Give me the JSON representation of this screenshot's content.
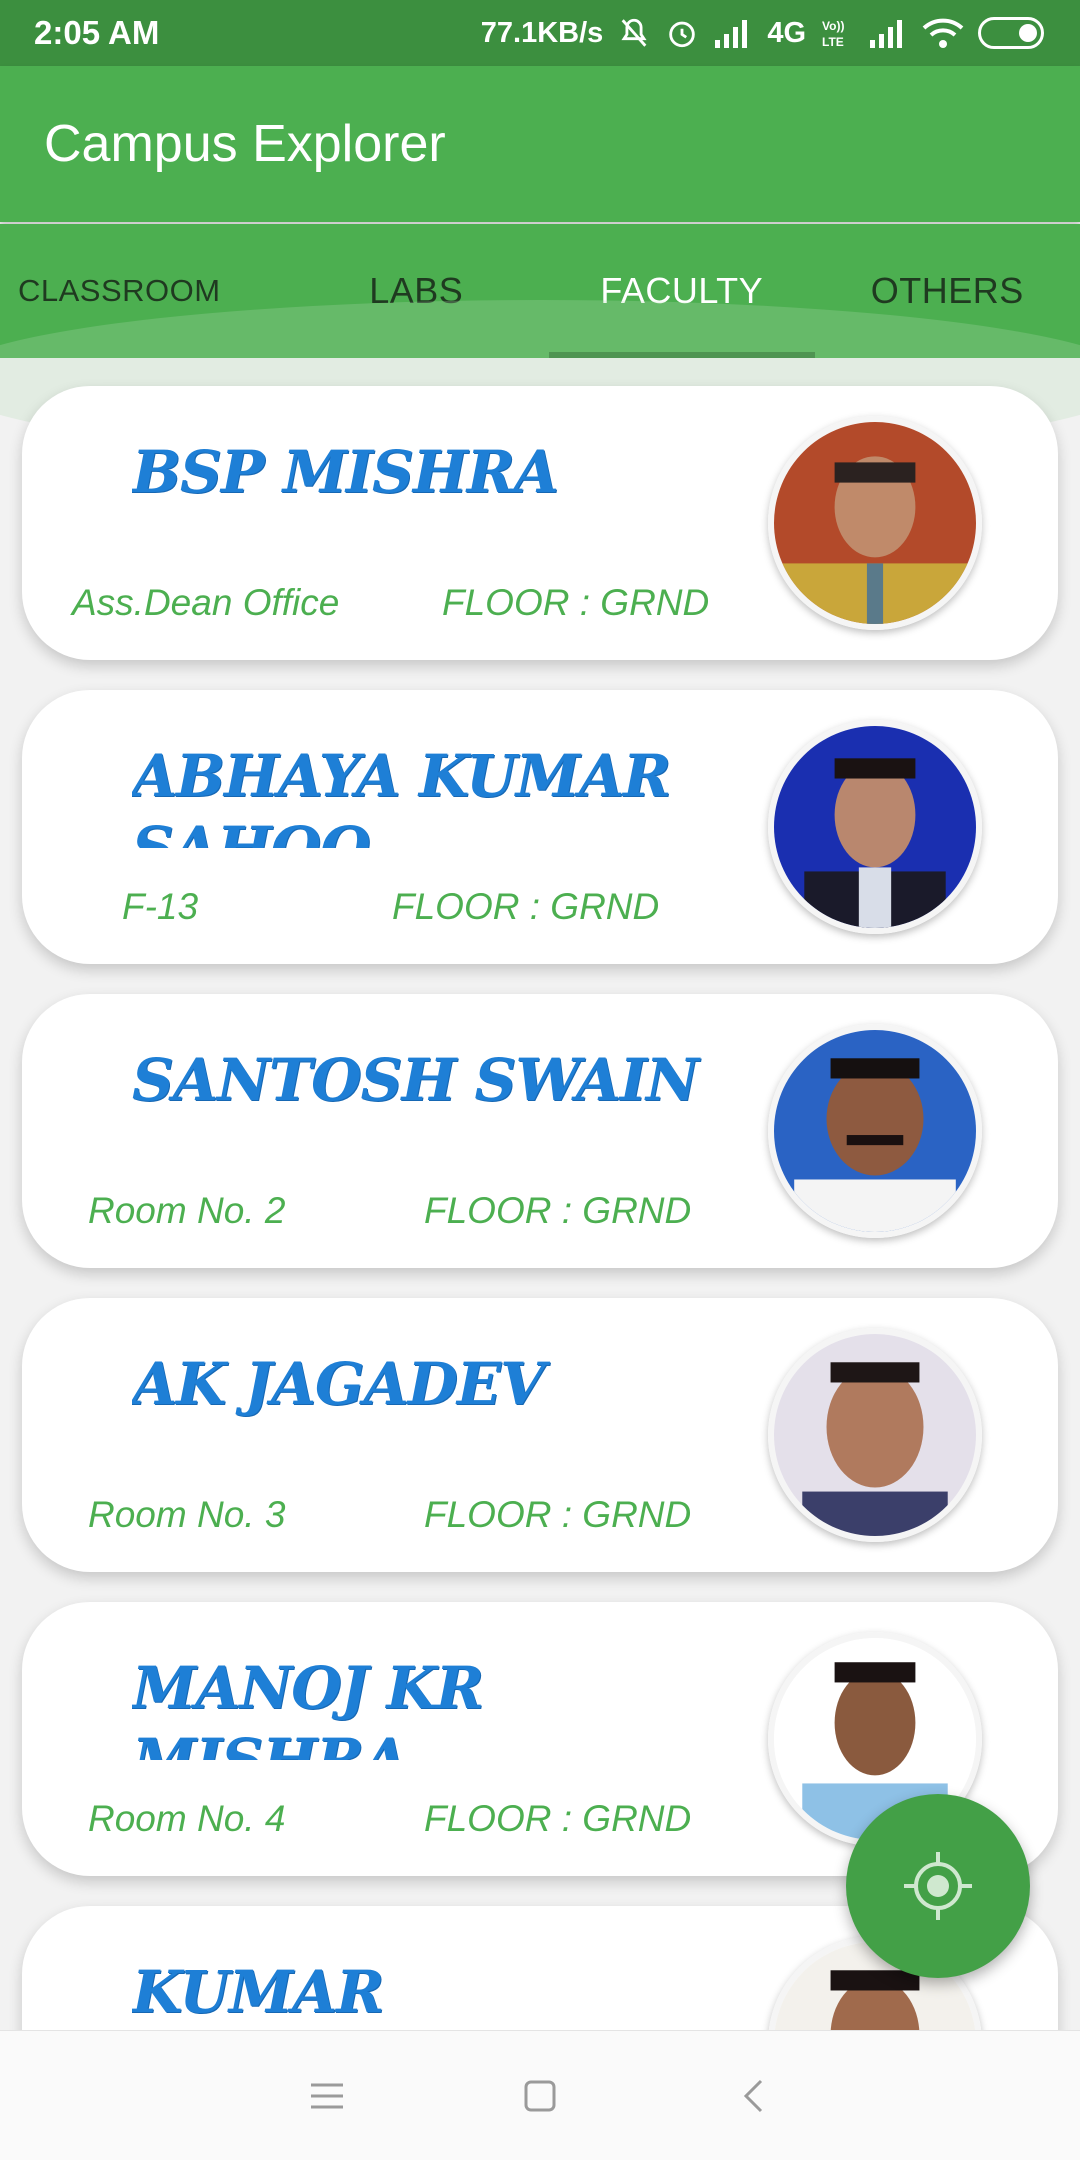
{
  "status_bar": {
    "time": "2:05 AM",
    "speed": "77.1KB/s",
    "network": "4G",
    "icons": [
      "mute-icon",
      "alarm-icon",
      "signal-icon",
      "volte-icon",
      "signal-icon",
      "wifi-icon",
      "battery-icon"
    ]
  },
  "app_bar": {
    "title": "Campus Explorer"
  },
  "tabs": [
    {
      "label": "CLASSROOM",
      "active": false
    },
    {
      "label": "LABS",
      "active": false
    },
    {
      "label": "FACULTY",
      "active": true
    },
    {
      "label": "OTHERS",
      "active": false
    }
  ],
  "faculty": [
    {
      "name": "BSP MISHRA",
      "room": "Ass.Dean Office",
      "floor": "FLOOR : GRND"
    },
    {
      "name": "ABHAYA KUMAR SAHOO",
      "room": "F-13",
      "floor": "FLOOR : GRND"
    },
    {
      "name": "SANTOSH SWAIN",
      "room": "Room No. 2",
      "floor": "FLOOR : GRND"
    },
    {
      "name": "AK JAGADEV",
      "room": "Room No. 3",
      "floor": "FLOOR : GRND"
    },
    {
      "name": "MANOJ KR MISHRA",
      "room": "Room No. 4",
      "floor": "FLOOR : GRND"
    },
    {
      "name": "KUMAR DEVDUTTA",
      "room": "",
      "floor": ""
    }
  ],
  "fab": {
    "icon": "locate-icon"
  },
  "nav_bar": {
    "icons": [
      "menu-icon",
      "home-icon",
      "back-icon"
    ]
  },
  "colors": {
    "primary": "#4caf50",
    "status_bar": "#3c8f3f",
    "name_text": "#1e7fd6",
    "detail_text": "#4caf50"
  }
}
